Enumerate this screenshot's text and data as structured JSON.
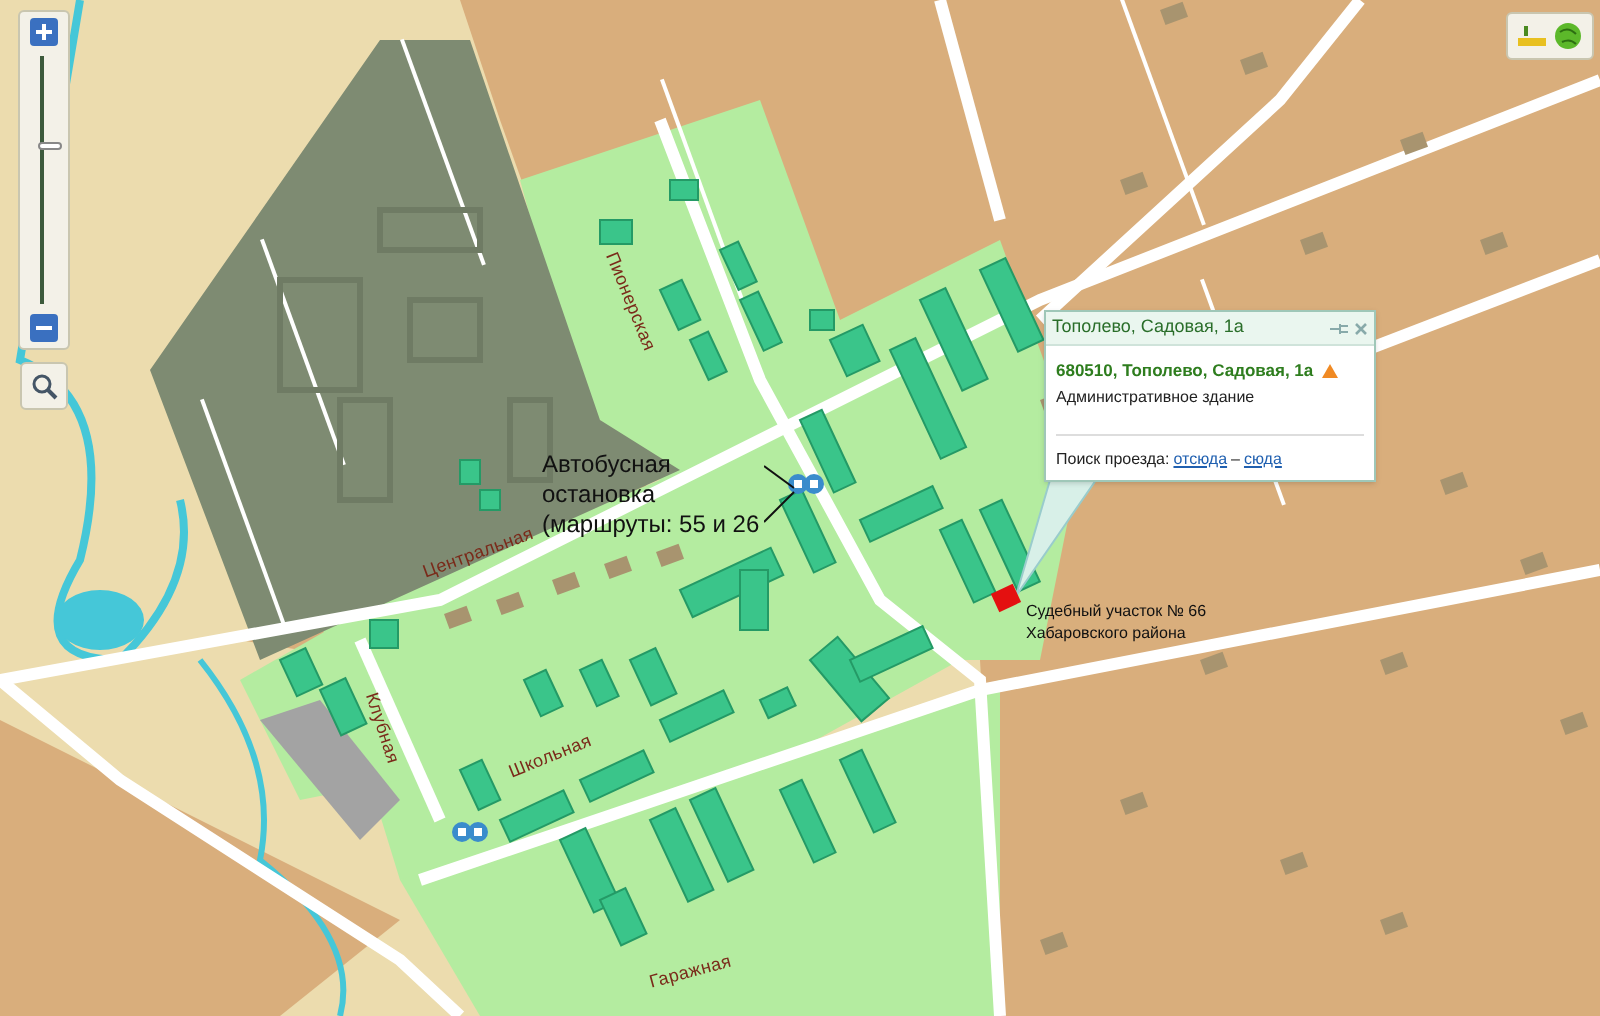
{
  "zoom_control": {
    "level": 0.64
  },
  "street_labels": [
    {
      "text": "Пионерская"
    },
    {
      "text": "Центральная"
    },
    {
      "text": "Клубная"
    },
    {
      "text": "Школьная"
    },
    {
      "text": "Гаражная"
    }
  ],
  "annotations": [
    {
      "kind": "bus",
      "lines": [
        "Автобусная",
        "остановка",
        "(маршруты: 55 и 26"
      ]
    },
    {
      "kind": "site",
      "lines": [
        "Судебный участок № 66",
        "Хабаровского района"
      ]
    }
  ],
  "popup": {
    "title": "Тополево, Садовая, 1а",
    "address": "680510, Тополево, Садовая, 1а",
    "description": "Административное здание",
    "route_label": "Поиск проезда:",
    "route_from": "отсюда",
    "route_separator": "–",
    "route_to": "сюда"
  }
}
